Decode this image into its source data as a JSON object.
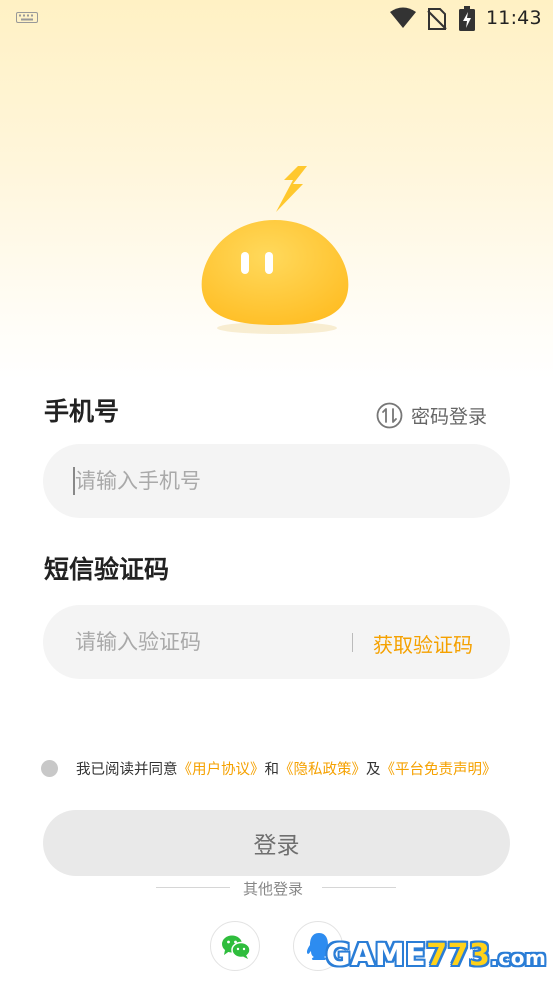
{
  "status_bar": {
    "time": "11:43",
    "icons": [
      "keyboard-icon",
      "wifi-icon",
      "no-sim-icon",
      "battery-charging-icon"
    ]
  },
  "login": {
    "phone_label": "手机号",
    "password_login_label": "密码登录",
    "phone_placeholder": "请输入手机号",
    "code_label": "短信验证码",
    "code_placeholder": "请输入验证码",
    "get_code_label": "获取验证码",
    "agreement": {
      "prefix": "我已阅读并同意",
      "user_agreement": "《用户协议》",
      "and": "和",
      "privacy_policy": "《隐私政策》",
      "also": "及",
      "disclaimer": "《平台免责声明》"
    },
    "submit_label": "登录",
    "other_login_label": "其他登录",
    "social": [
      "wechat-icon",
      "qq-icon"
    ]
  },
  "watermark": {
    "prefix": "GAME",
    "number": "773",
    "suffix": ".com"
  },
  "colors": {
    "accent": "#f5a100",
    "mascot": "#ffc93a",
    "field_bg": "#f4f4f4",
    "button_bg": "#e9e9e9"
  }
}
